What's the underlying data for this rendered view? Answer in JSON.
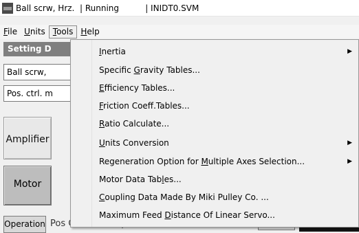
{
  "titlebar": {
    "segments": [
      "Ball scrw, Hrz.",
      "  | Running",
      "          | INIDT0.SVM"
    ]
  },
  "menubar": {
    "items": [
      {
        "pre": "",
        "ul": "F",
        "post": "ile"
      },
      {
        "pre": "",
        "ul": "U",
        "post": "nits"
      },
      {
        "pre": "",
        "ul": "T",
        "post": "ools"
      },
      {
        "pre": "",
        "ul": "H",
        "post": "elp"
      }
    ]
  },
  "background": {
    "panel_header": "Setting D",
    "field1": "Ball scrw, ",
    "field2": "Pos. ctrl. m",
    "amplifier_label": "Amplifier",
    "motor_label": "Motor",
    "operation_label": "Operation",
    "pattern_text": "Pos Ctrl Mode Oper. Pattern"
  },
  "tools_menu": {
    "items": [
      {
        "pre": "",
        "ul": "I",
        "post": "nertia",
        "submenu": true
      },
      {
        "pre": "Specific ",
        "ul": "G",
        "post": "ravity Tables...",
        "submenu": false
      },
      {
        "pre": "",
        "ul": "E",
        "post": "fficiency Tables...",
        "submenu": false
      },
      {
        "pre": "",
        "ul": "F",
        "post": "riction Coeff.Tables...",
        "submenu": false
      },
      {
        "pre": "",
        "ul": "R",
        "post": "atio Calculate...",
        "submenu": false
      },
      {
        "pre": "",
        "ul": "U",
        "post": "nits Conversion",
        "submenu": true
      },
      {
        "pre": "Regeneration Option for ",
        "ul": "M",
        "post": "ultiple Axes Selection...",
        "submenu": true
      },
      {
        "pre": "Motor Data Tab",
        "ul": "l",
        "post": "es...",
        "submenu": false
      },
      {
        "pre": "",
        "ul": "C",
        "post": "oupling Data Made By Miki Pulley Co. ...",
        "submenu": false
      },
      {
        "pre": "Maximum Feed ",
        "ul": "D",
        "post": "istance Of Linear Servo...",
        "submenu": false
      }
    ]
  },
  "icons": {
    "submenu_arrow": "▶"
  }
}
